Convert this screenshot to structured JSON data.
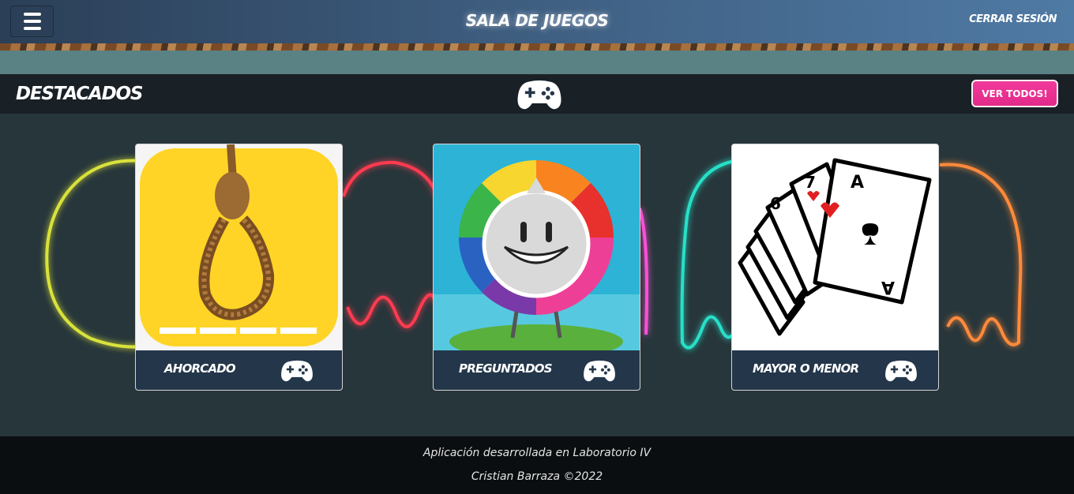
{
  "navbar": {
    "menu_icon": "hamburger-icon",
    "brand": "Sala de Juegos",
    "logout": "Cerrar sesión"
  },
  "section": {
    "title": "Destacados",
    "icon": "gamepad-icon",
    "see_all": "VER TODOS!"
  },
  "games": [
    {
      "name": "Ahorcado",
      "image": "noose-icon",
      "icon": "gamepad-icon"
    },
    {
      "name": "Preguntados",
      "image": "preguntados-wheel-icon",
      "icon": "gamepad-icon"
    },
    {
      "name": "Mayor o menor",
      "image": "playing-cards-icon",
      "icon": "gamepad-icon"
    }
  ],
  "footer": {
    "line1": "Aplicación desarrollada en Laboratorio IV",
    "line2": "Cristian Barraza ©2022"
  },
  "colors": {
    "accent_pink": "#f23a9c",
    "card_footer": "#24364a",
    "header_dark": "#192127",
    "neon_yellow": "#d9e23a",
    "neon_red": "#ff3b4f",
    "neon_cyan": "#27e0c8",
    "neon_orange": "#ff8a3a",
    "neon_magenta": "#ff4fd8"
  }
}
